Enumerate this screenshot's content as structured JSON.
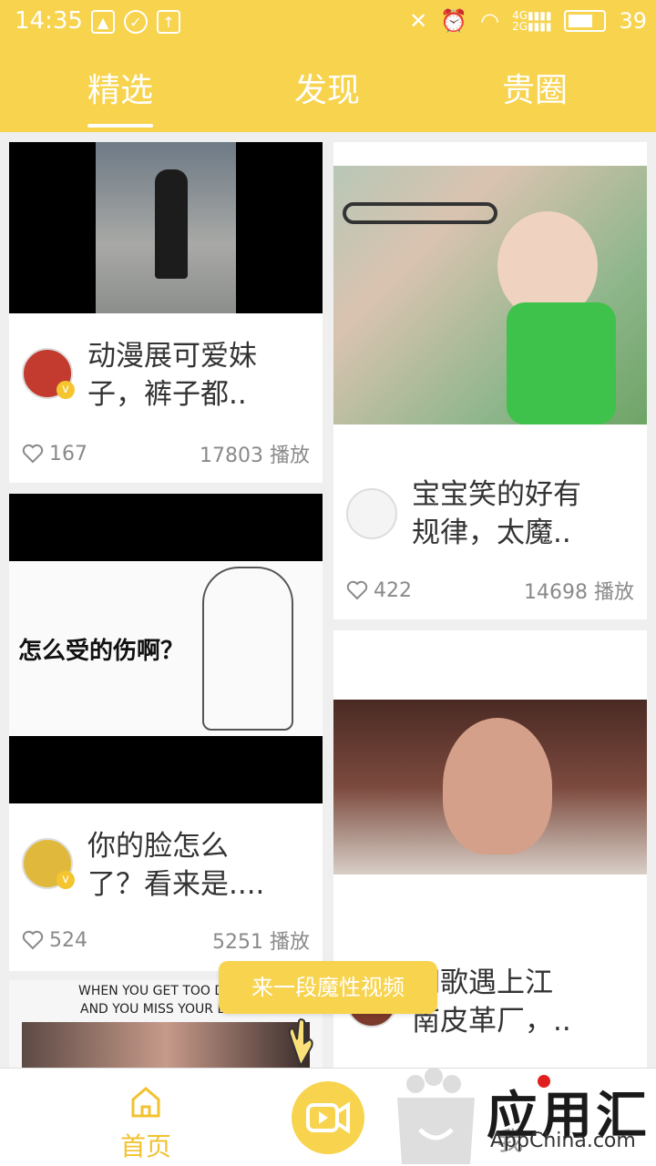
{
  "status_bar": {
    "time": "14:35",
    "battery": "39"
  },
  "tabs": [
    {
      "label": "精选",
      "active": true
    },
    {
      "label": "发现",
      "active": false
    },
    {
      "label": "贵圈",
      "active": false
    }
  ],
  "cards": [
    {
      "title_line1": "动漫展可爱妹",
      "title_line2": "子，裤子都..",
      "likes": "167",
      "plays": "17803 播放"
    },
    {
      "title_line1": "宝宝笑的好有",
      "title_line2": "规律，太魔..",
      "likes": "422",
      "plays": "14698 播放"
    },
    {
      "title_line1": "你的脸怎么",
      "title_line2": "了？看来是....",
      "likes": "524",
      "plays": "5251 播放",
      "thumb_text": "怎么受的伤啊？"
    },
    {
      "title_line1": "胡歌遇上江",
      "title_line2": "南皮革厂，.."
    },
    {
      "thumb_text1": "WHEN YOU GET TOO D",
      "thumb_text2": "AND YOU MISS YOUR B"
    }
  ],
  "bubble": {
    "text": "来一段魔性视频"
  },
  "bottom_nav": {
    "home": "首页",
    "me": "我"
  },
  "watermark": {
    "brand": "应用汇",
    "domain": "AppChina.com"
  },
  "colors": {
    "accent": "#f7d34e",
    "accent_text": "#f2c230"
  }
}
